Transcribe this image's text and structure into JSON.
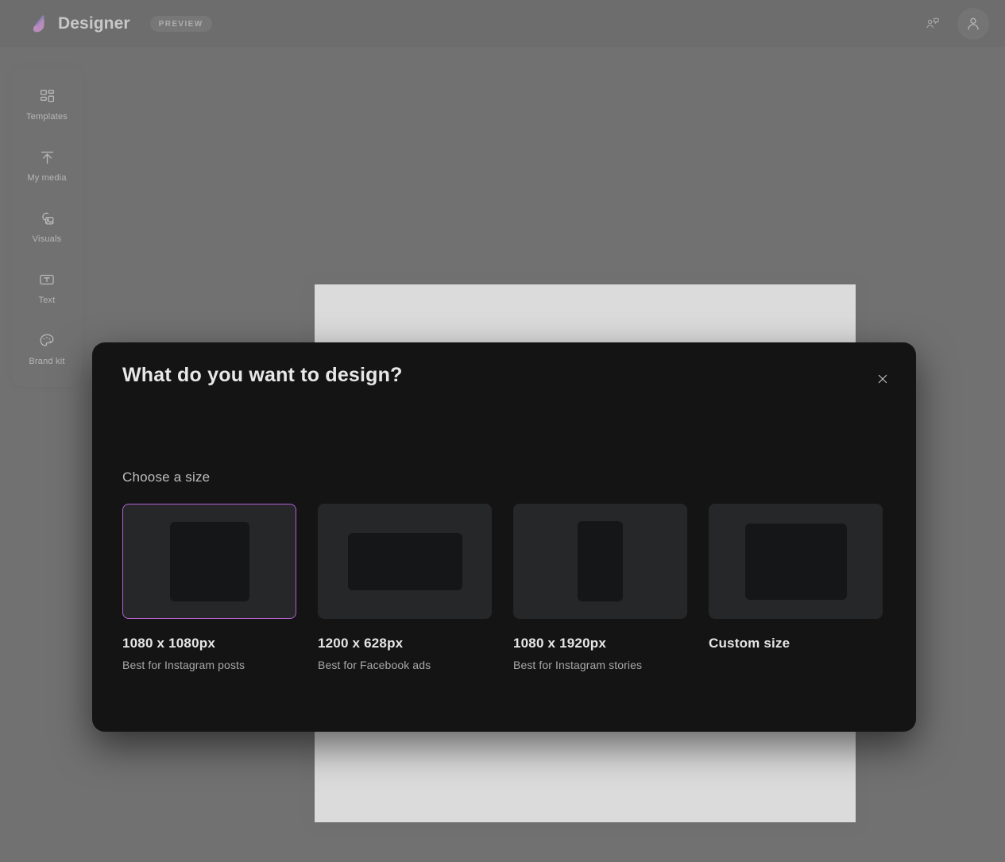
{
  "app": {
    "brand_name": "Designer",
    "preview_badge": "PREVIEW",
    "logo_icon": "designer-logo-icon",
    "accent_color": "#b45fd1",
    "logo_gradient_from": "#7b3fb5",
    "logo_gradient_to": "#c955b8"
  },
  "topbar": {
    "feedback_icon": "feedback-people-icon",
    "account_icon": "account-avatar-icon"
  },
  "sidebar": {
    "items": [
      {
        "label": "Templates",
        "icon": "templates-grid-icon"
      },
      {
        "label": "My media",
        "icon": "upload-arrow-icon"
      },
      {
        "label": "Visuals",
        "icon": "visuals-image-icon"
      },
      {
        "label": "Text",
        "icon": "text-box-icon"
      },
      {
        "label": "Brand kit",
        "icon": "palette-icon"
      }
    ]
  },
  "modal": {
    "title": "What do you want to design?",
    "close_icon": "close-icon",
    "section_label": "Choose a size",
    "sizes": [
      {
        "title": "1080 x 1080px",
        "subtitle": "Best for Instagram posts",
        "shape": "square",
        "selected": true
      },
      {
        "title": "1200 x 628px",
        "subtitle": "Best for Facebook ads",
        "shape": "landscape",
        "selected": false
      },
      {
        "title": "1080 x 1920px",
        "subtitle": "Best for Instagram stories",
        "shape": "portrait",
        "selected": false
      },
      {
        "title": "Custom size",
        "subtitle": "",
        "shape": "custom",
        "selected": false
      }
    ]
  }
}
